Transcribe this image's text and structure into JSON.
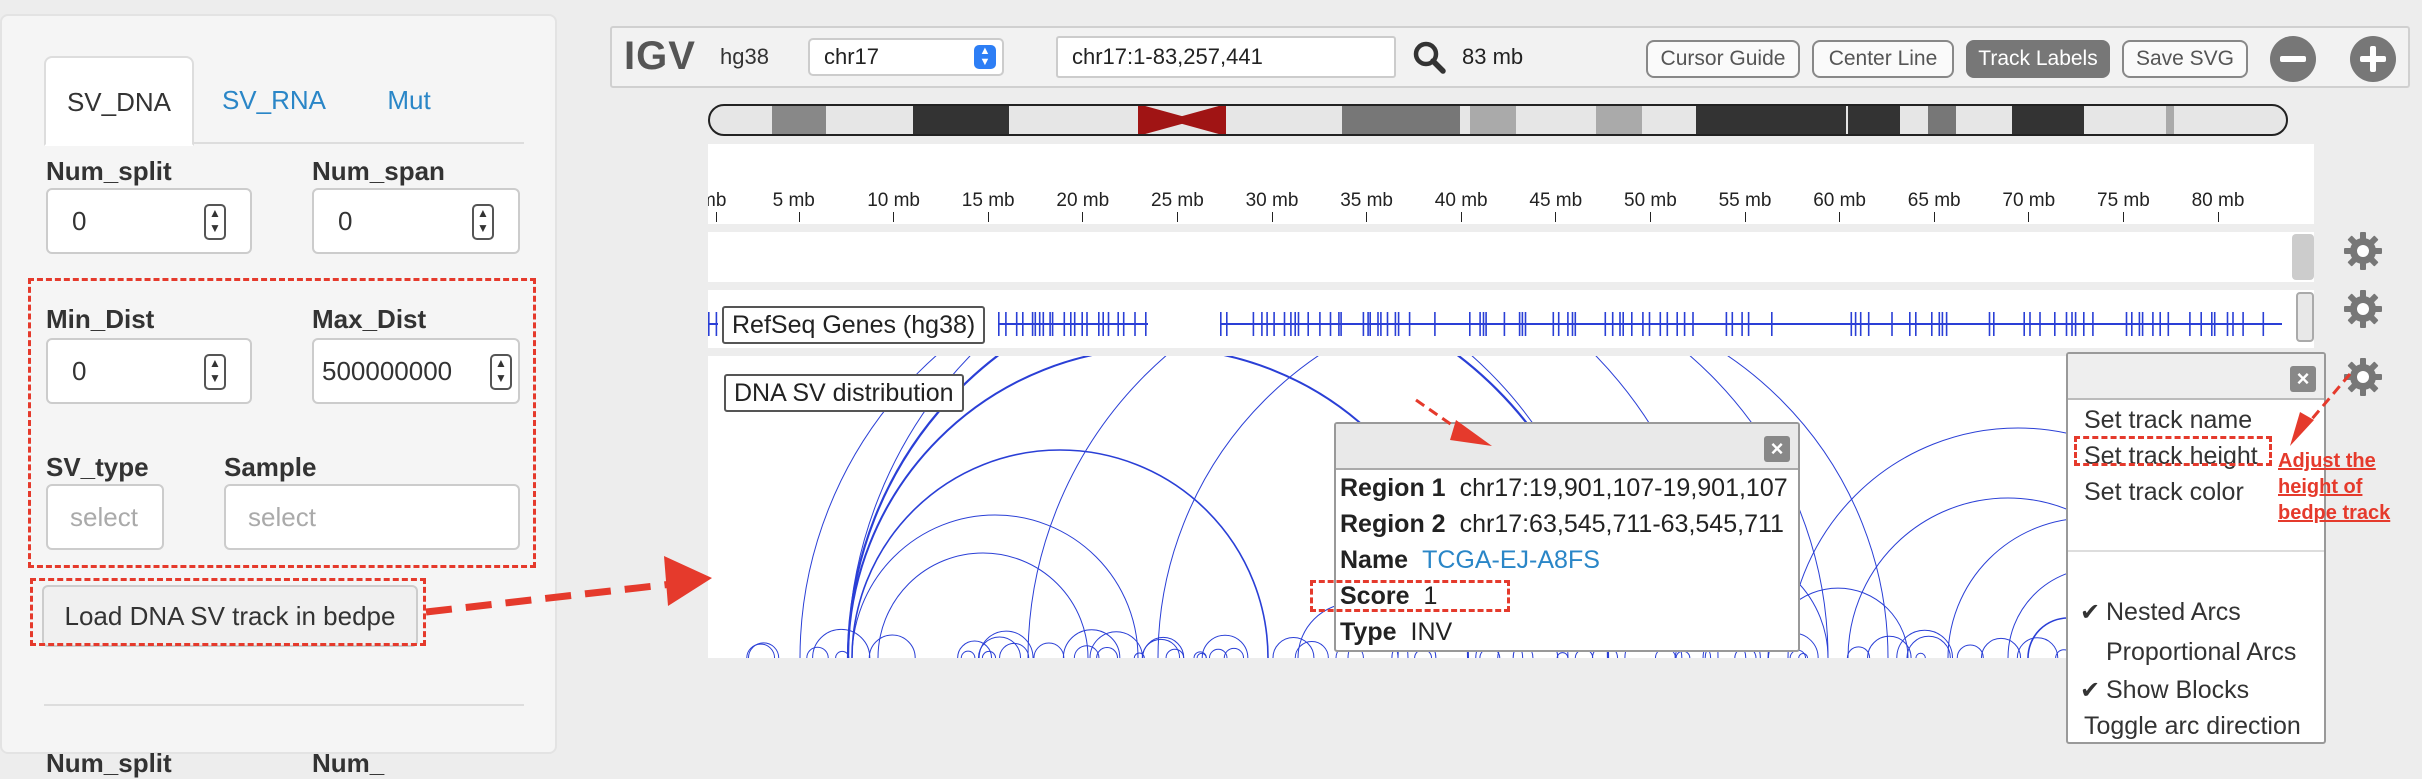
{
  "left_panel": {
    "tabs": [
      {
        "label": "SV_DNA",
        "active": true
      },
      {
        "label": "SV_RNA",
        "active": false
      },
      {
        "label": "Mut",
        "active": false
      }
    ],
    "num_split": {
      "label": "Num_split",
      "value": "0"
    },
    "num_span": {
      "label": "Num_span",
      "value": "0"
    },
    "min_dist": {
      "label": "Min_Dist",
      "value": "0"
    },
    "max_dist": {
      "label": "Max_Dist",
      "value": "500000000"
    },
    "sv_type": {
      "label": "SV_type",
      "placeholder": "select"
    },
    "sample": {
      "label": "Sample",
      "placeholder": "select"
    },
    "load_button": "Load DNA SV track in bedpe",
    "next_num_split": "Num_split",
    "next_num_span": "Num_"
  },
  "igv": {
    "logo": "IGV",
    "genome": "hg38",
    "chromosome": "chr17",
    "locus": "chr17:1-83,257,441",
    "zoom": "83 mb",
    "buttons": {
      "cursor_guide": "Cursor Guide",
      "center_line": "Center Line",
      "track_labels": "Track Labels",
      "save_svg": "Save SVG"
    },
    "ruler_ticks": [
      "mb",
      "5 mb",
      "10 mb",
      "15 mb",
      "20 mb",
      "25 mb",
      "30 mb",
      "35 mb",
      "40 mb",
      "45 mb",
      "50 mb",
      "55 mb",
      "60 mb",
      "65 mb",
      "70 mb",
      "75 mb",
      "80 mb"
    ],
    "tracks": {
      "refseq": "RefSeq Genes (hg38)",
      "sv": "DNA SV distribution"
    },
    "popup": {
      "region1_label": "Region 1",
      "region1_value": "chr17:19,901,107-19,901,107",
      "region2_label": "Region 2",
      "region2_value": "chr17:63,545,711-63,545,711",
      "name_label": "Name",
      "name_value": "TCGA-EJ-A8FS",
      "score_label": "Score",
      "score_value": "1",
      "type_label": "Type",
      "type_value": "INV"
    },
    "menu": {
      "set_track_name": "Set track name",
      "set_track_height": "Set track height",
      "set_track_color": "Set track color",
      "nested_arcs": "Nested Arcs",
      "proportional_arcs": "Proportional Arcs",
      "show_blocks": "Show Blocks",
      "toggle_arc_direction": "Toggle arc direction"
    },
    "annotation": "Adjust the height of bedpe track"
  },
  "colors": {
    "accent_blue": "#2a86c7",
    "annotation_red": "#e53a2c",
    "arc_blue": "#2a3fd6"
  },
  "icons": [
    "search-icon",
    "gear-icon",
    "close-icon",
    "minus-icon",
    "plus-icon",
    "check-icon",
    "spinner-icon",
    "chevron-updown-icon"
  ]
}
